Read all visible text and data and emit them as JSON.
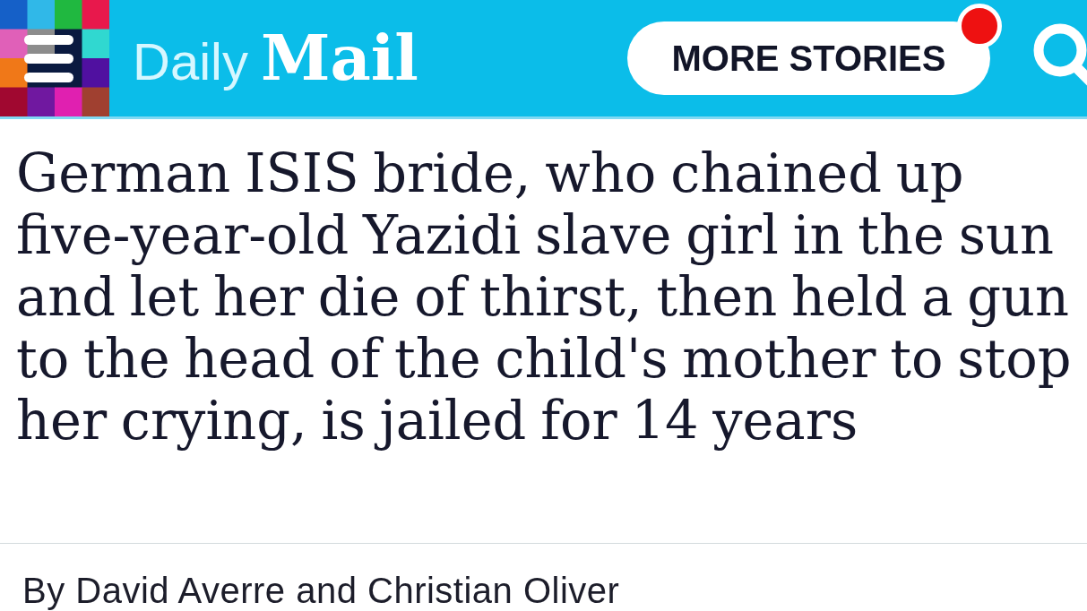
{
  "header": {
    "logo": "Daily **Mail**",
    "more_stories": {
      "label": "MORE STORIES",
      "has_notification": true
    }
  },
  "article": {
    "headline": "German ISIS bride, who chained up five-year-old Yazidi slave girl in the sun and let her die of thirst, then held a gun to the head of the child's mother to stop her crying, is jailed for 14 years",
    "byline": "By David Averre and Christian Oliver"
  }
}
